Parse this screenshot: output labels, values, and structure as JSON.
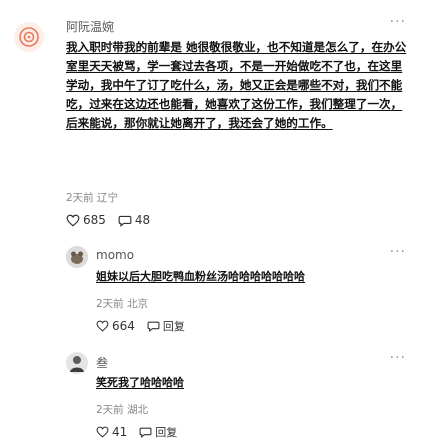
{
  "post": {
    "username": "阿阮温婉",
    "more": "···",
    "text": "我入职时带我的前辈是 她很敬很敬业，也不知道是怎么了，在办公室里天天被骂，学一套过去各项，不是一开始做吃不了也，在这里学动，我中午了订了吃什么，汤，她又正会是哪些不对，我们不能吃，过来在这边还也能看，她喜欢了这份工作，我们整理了一次，后来能说，那你就让她离开了，我还会了她的工作。",
    "time": "2天前",
    "location": "辽宁",
    "likes": "685",
    "comments": "48"
  },
  "replies": [
    {
      "name": "momo",
      "text": "姐妹以后大胆吃鸭血粉丝汤哈哈哈哈哈哈哈",
      "time": "2天前",
      "location": "北京",
      "likes": "664",
      "reply_label": "回复"
    },
    {
      "name": "叁",
      "text": "笑死我了哈哈哈哈",
      "time": "2天前",
      "location": "湖北",
      "likes": "41",
      "reply_label": "回复"
    }
  ]
}
